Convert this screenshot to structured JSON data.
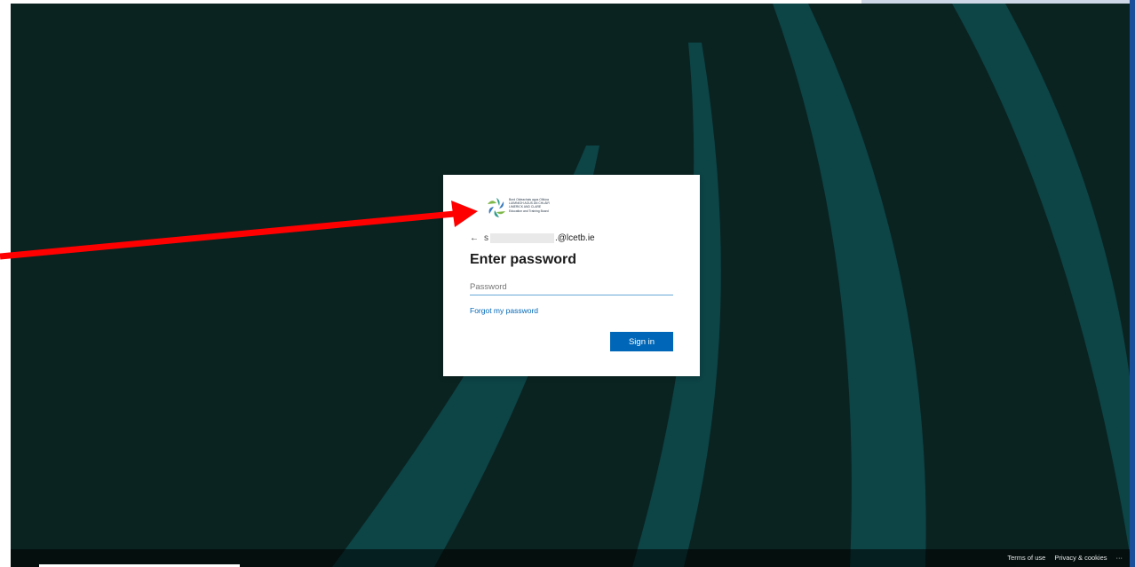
{
  "login": {
    "org_logo_lines": [
      "Bord Oideachais agus Oiliúna",
      "LUIMNIGH AGUS AN CHLÁIR",
      "LIMERICK AND CLARE",
      "Education and Training Board"
    ],
    "identity_prefix": "s",
    "identity_suffix": ".@lcetb.ie",
    "title": "Enter password",
    "password_placeholder": "Password",
    "forgot_link": "Forgot my password",
    "signin_button": "Sign in"
  },
  "footer": {
    "terms": "Terms of use",
    "privacy": "Privacy & cookies",
    "more": "···"
  },
  "colors": {
    "background": "#0a2321",
    "accent_stripe": "#0d4446",
    "button": "#0067b8",
    "link": "#0067b8",
    "annotation_arrow": "#ff0000"
  },
  "icons": [
    "back-arrow-icon",
    "org-logo",
    "annotation-arrow"
  ]
}
